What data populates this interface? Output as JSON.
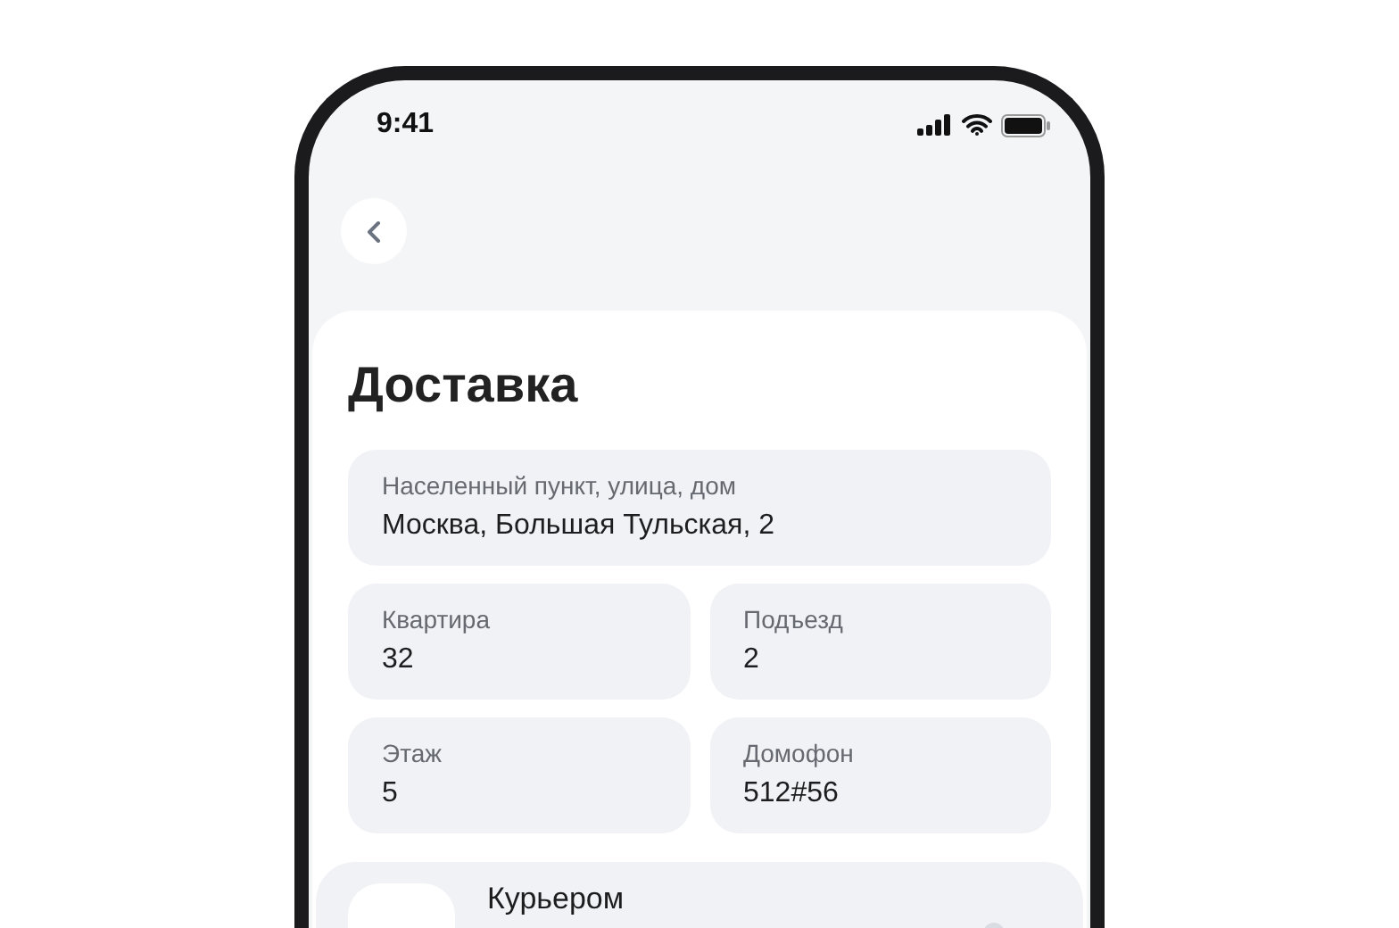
{
  "status_bar": {
    "time": "9:41"
  },
  "title": "Доставка",
  "address": {
    "label": "Населенный пункт, улица, дом",
    "value": "Москва, Большая Тульская, 2"
  },
  "fields": [
    {
      "label": "Квартира",
      "value": "32"
    },
    {
      "label": "Подъезд",
      "value": "2"
    },
    {
      "label": "Этаж",
      "value": "5"
    },
    {
      "label": "Домофон",
      "value": "512#56"
    }
  ],
  "delivery_option": {
    "label": "Курьером"
  }
}
